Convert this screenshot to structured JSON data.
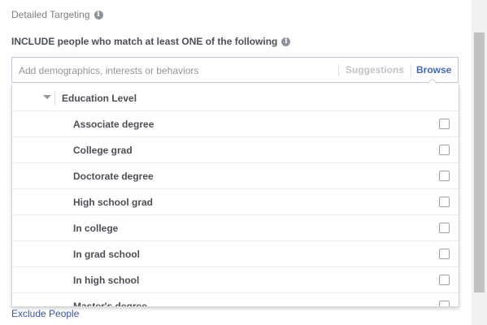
{
  "section": {
    "title": "Detailed Targeting",
    "info_icon": "i"
  },
  "include": {
    "label": "INCLUDE people who match at least ONE of the following",
    "info_icon": "i"
  },
  "search": {
    "placeholder": "Add demographics, interests or behaviors",
    "value": "",
    "suggestions_label": "Suggestions",
    "browse_label": "Browse"
  },
  "dropdown": {
    "group_label": "Education Level",
    "options": [
      {
        "label": "Associate degree",
        "checked": false
      },
      {
        "label": "College grad",
        "checked": false
      },
      {
        "label": "Doctorate degree",
        "checked": false
      },
      {
        "label": "High school grad",
        "checked": false
      },
      {
        "label": "In college",
        "checked": false
      },
      {
        "label": "In grad school",
        "checked": false
      },
      {
        "label": "In high school",
        "checked": false
      },
      {
        "label": "Master's degree",
        "checked": false
      }
    ]
  },
  "exclude": {
    "label": "Exclude People"
  },
  "colors": {
    "link": "#365899",
    "browse": "#4267b2",
    "border": "#bdc7d8"
  }
}
